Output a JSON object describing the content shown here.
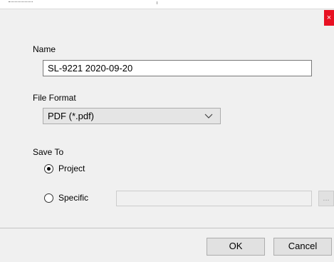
{
  "dialog": {
    "close_glyph": "×",
    "browse_glyph": "..."
  },
  "name_section": {
    "label": "Name",
    "value": "SL-9221 2020-09-20"
  },
  "format_section": {
    "label": "File Format",
    "selected": "PDF (*.pdf)"
  },
  "save_to": {
    "label": "Save To",
    "options": [
      {
        "label": "Project",
        "selected": true
      },
      {
        "label": "Specific",
        "selected": false
      }
    ],
    "specific_path": ""
  },
  "buttons": {
    "ok": "OK",
    "cancel": "Cancel"
  },
  "colors": {
    "close_button": "#e81123",
    "dialog_bg": "#f0f0f0"
  }
}
